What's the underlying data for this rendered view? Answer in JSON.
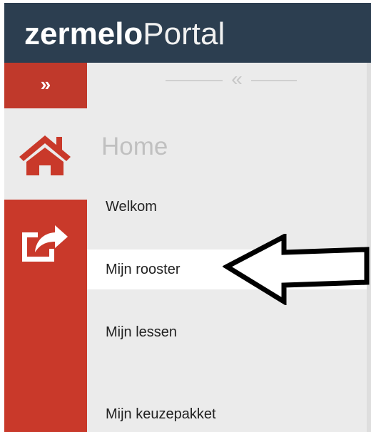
{
  "header": {
    "logo_bold": "zermelo",
    "logo_light": "Portal"
  },
  "sidebar": {
    "expand_label": "»",
    "collapse_label": "«",
    "icons": [
      {
        "name": "home-icon",
        "active": true
      },
      {
        "name": "share-icon",
        "active": false
      }
    ]
  },
  "menu": {
    "section_title": "Home",
    "items": [
      {
        "label": "Welkom"
      },
      {
        "label": "Mijn rooster"
      },
      {
        "label": "Mijn lessen"
      },
      {
        "label": "Mijn keuzepakket"
      }
    ]
  },
  "colors": {
    "header_bg": "#2c3e50",
    "accent_red": "#c9392a",
    "menu_bg": "#ebebeb",
    "active_bg": "#ffffff"
  }
}
